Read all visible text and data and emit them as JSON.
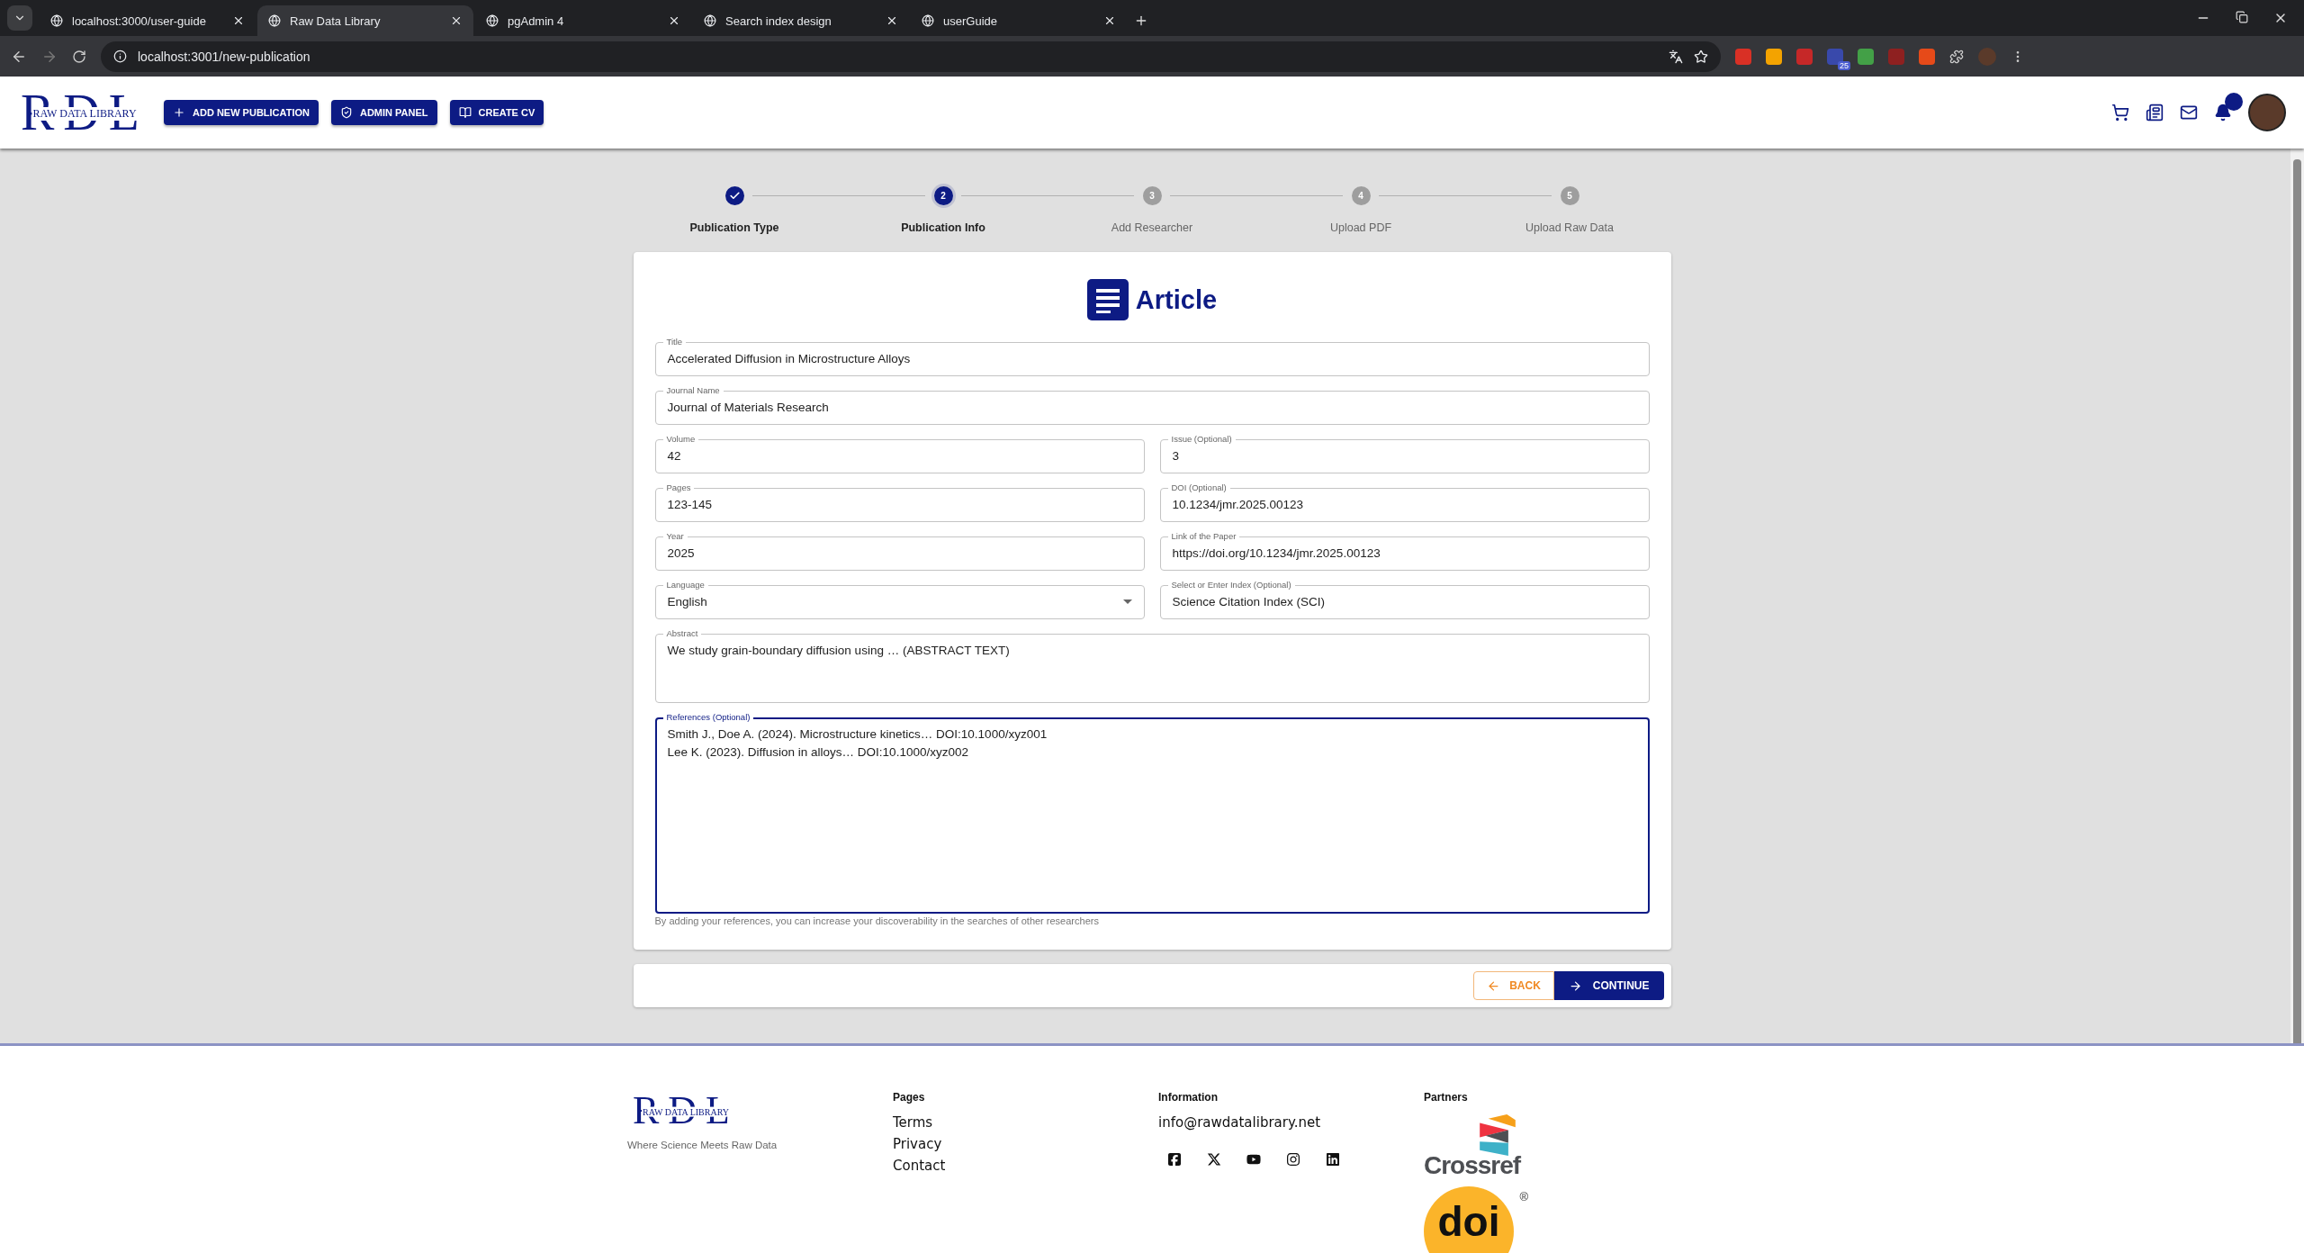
{
  "browser": {
    "tabs": [
      {
        "title": "localhost:3000/user-guide",
        "selected": false
      },
      {
        "title": "Raw Data Library",
        "selected": true
      },
      {
        "title": "pgAdmin 4",
        "selected": false
      },
      {
        "title": "Search index design",
        "selected": false
      },
      {
        "title": "userGuide",
        "selected": false
      }
    ],
    "url": "localhost:3001/new-publication",
    "extension_badge": "25"
  },
  "header": {
    "logo": {
      "letters": "RDL",
      "caption": "RAW DATA LIBRARY"
    },
    "buttons": [
      {
        "kind": "add",
        "label": "ADD NEW PUBLICATION"
      },
      {
        "kind": "admin",
        "label": "ADMIN PANEL"
      },
      {
        "kind": "cv",
        "label": "CREATE CV"
      }
    ],
    "notification_dot": true
  },
  "stepper": [
    {
      "label": "Publication Type",
      "completed": true,
      "selected": false
    },
    {
      "label": "Publication Info",
      "completed": false,
      "selected": true,
      "number": "2"
    },
    {
      "label": "Add Researcher",
      "completed": false,
      "selected": false,
      "number": "3"
    },
    {
      "label": "Upload PDF",
      "completed": false,
      "selected": false,
      "number": "4"
    },
    {
      "label": "Upload Raw Data",
      "completed": false,
      "selected": false,
      "number": "5"
    }
  ],
  "form": {
    "heading": "Article",
    "rows": [
      [
        {
          "label": "Title",
          "value": "Accelerated Diffusion in Microstructure Alloys",
          "kind": "text"
        }
      ],
      [
        {
          "label": "Journal Name",
          "value": "Journal of Materials Research",
          "kind": "text"
        }
      ],
      [
        {
          "label": "Volume",
          "value": "42",
          "kind": "text"
        },
        {
          "label": "Issue (Optional)",
          "value": "3",
          "kind": "text"
        }
      ],
      [
        {
          "label": "Pages",
          "value": "123-145",
          "kind": "text"
        },
        {
          "label": "DOI (Optional)",
          "value": "10.1234/jmr.2025.00123",
          "kind": "text"
        }
      ],
      [
        {
          "label": "Year",
          "value": "2025",
          "kind": "text"
        },
        {
          "label": "Link of the Paper",
          "value": "https://doi.org/10.1234/jmr.2025.00123",
          "kind": "text"
        }
      ],
      [
        {
          "label": "Language",
          "value": "English",
          "kind": "select"
        },
        {
          "label": "Select or Enter Index (Optional)",
          "value": "Science Citation Index (SCI)",
          "kind": "text"
        }
      ],
      [
        {
          "label": "Abstract",
          "value": "We study grain-boundary diffusion using … (ABSTRACT TEXT)",
          "kind": "textarea",
          "focused": false
        }
      ],
      [
        {
          "label": "References (Optional)",
          "value": "Smith J., Doe A. (2024). Microstructure kinetics… DOI:10.1000/xyz001\nLee K. (2023). Diffusion in alloys… DOI:10.1000/xyz002",
          "kind": "textarea_large",
          "focused": true,
          "helper": "By adding your references, you can increase your discoverability in the searches of other researchers"
        }
      ]
    ]
  },
  "actions": {
    "back": "BACK",
    "continue": "CONTINUE"
  },
  "footer": {
    "logo": {
      "letters": "RDL",
      "caption": "RAW DATA LIBRARY"
    },
    "tagline": "Where Science Meets Raw Data",
    "pages": {
      "heading": "Pages",
      "links": [
        "Terms",
        "Privacy",
        "Contact"
      ]
    },
    "information": {
      "heading": "Information",
      "email": "info@rawdatalibrary.net",
      "social": [
        {
          "kind": "facebook"
        },
        {
          "kind": "x"
        },
        {
          "kind": "youtube"
        },
        {
          "kind": "instagram"
        },
        {
          "kind": "linkedin"
        }
      ]
    },
    "partners": {
      "heading": "Partners",
      "crossref": "Crossref",
      "doi": "doi",
      "doi_mark": "®"
    }
  }
}
